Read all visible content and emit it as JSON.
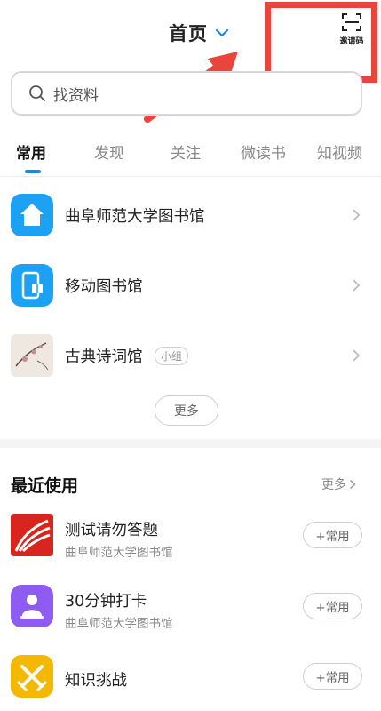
{
  "header": {
    "title": "首页",
    "scan_label": "邀请码"
  },
  "search": {
    "placeholder": "找资料"
  },
  "tabs": [
    {
      "label": "常用",
      "active": true
    },
    {
      "label": "发现",
      "active": false
    },
    {
      "label": "关注",
      "active": false
    },
    {
      "label": "微读书",
      "active": false
    },
    {
      "label": "知视频",
      "active": false
    }
  ],
  "common_items": [
    {
      "label": "曲阜师范大学图书馆",
      "icon": "home-icon"
    },
    {
      "label": "移动图书馆",
      "icon": "mobile-library-icon"
    },
    {
      "label": "古典诗词馆",
      "icon": "poetry-thumbnail",
      "badge": "小组"
    }
  ],
  "more_button": "更多",
  "recent": {
    "title": "最近使用",
    "more_label": "更多",
    "items": [
      {
        "name": "测试请勿答题",
        "sub": "曲阜师范大学图书馆",
        "action": "+常用",
        "icon": "xuexitong-logo-icon"
      },
      {
        "name": "30分钟打卡",
        "sub": "曲阜师范大学图书馆",
        "action": "+常用",
        "icon": "check-in-icon"
      },
      {
        "name": "知识挑战",
        "sub": "",
        "action": "+常用",
        "icon": "crossed-swords-icon"
      }
    ]
  },
  "colors": {
    "accent": "#1e88e5",
    "highlight": "#e8453c",
    "blue_icon": "#1da1f2",
    "red_icon": "#d8261e",
    "purple_icon": "#8e5cf0",
    "yellow_icon": "#f5b800"
  }
}
